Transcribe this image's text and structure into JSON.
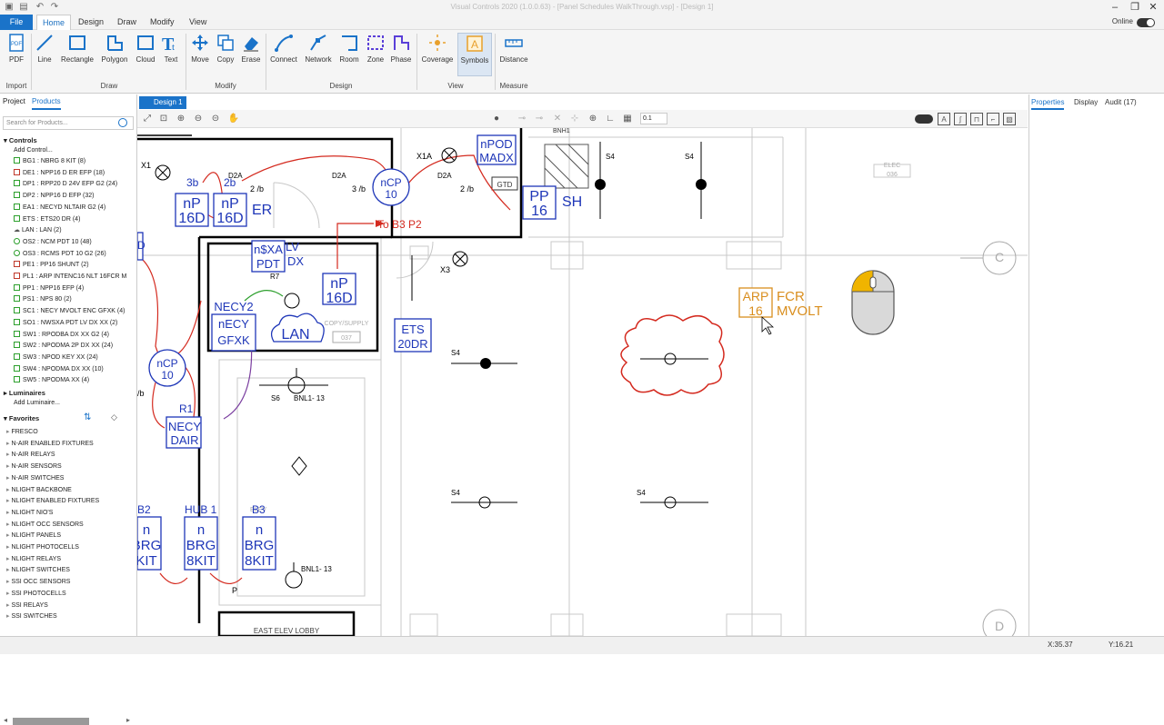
{
  "window": {
    "title": "Visual Controls 2020 (1.0.0.63) - [Panel Schedules WalkThrough.vsp] - [Design 1]",
    "online_label": "Online"
  },
  "menu": [
    "File",
    "Home",
    "Design",
    "Draw",
    "Modify",
    "View"
  ],
  "ribbon": {
    "tools": [
      {
        "id": "pdf",
        "label": "PDF"
      },
      {
        "id": "line",
        "label": "Line"
      },
      {
        "id": "rectangle",
        "label": "Rectangle"
      },
      {
        "id": "polygon",
        "label": "Polygon"
      },
      {
        "id": "cloud",
        "label": "Cloud"
      },
      {
        "id": "text",
        "label": "Text"
      },
      {
        "id": "move",
        "label": "Move"
      },
      {
        "id": "copy",
        "label": "Copy"
      },
      {
        "id": "erase",
        "label": "Erase"
      },
      {
        "id": "connect",
        "label": "Connect"
      },
      {
        "id": "network",
        "label": "Network"
      },
      {
        "id": "room",
        "label": "Room"
      },
      {
        "id": "zone",
        "label": "Zone"
      },
      {
        "id": "phase",
        "label": "Phase"
      },
      {
        "id": "coverage",
        "label": "Coverage"
      },
      {
        "id": "symbols",
        "label": "Symbols"
      },
      {
        "id": "distance",
        "label": "Distance"
      }
    ],
    "groups": [
      "Import",
      "Draw",
      "Modify",
      "Design",
      "View",
      "Measure"
    ]
  },
  "left_panel": {
    "tabs": [
      "Project",
      "Products"
    ],
    "search_placeholder": "Search for Products...",
    "controls_header": "Controls",
    "add_control": "Add Control...",
    "controls": [
      {
        "label": "BG1 : NBRG 8 KIT (8)",
        "color": "#2c9f2c",
        "shape": "square"
      },
      {
        "label": "DE1 : NPP16 D ER EFP (18)",
        "color": "#c0392b",
        "shape": "square"
      },
      {
        "label": "DP1 : RPP20 D 24V EFP G2 (24)",
        "color": "#2c9f2c",
        "shape": "square"
      },
      {
        "label": "DP2 : NPP16 D EFP (32)",
        "color": "#2c9f2c",
        "shape": "square"
      },
      {
        "label": "EA1 : NECYD NLTAIR G2 (4)",
        "color": "#2c9f2c",
        "shape": "square"
      },
      {
        "label": "ETS : ETS20 DR (4)",
        "color": "#2c9f2c",
        "shape": "square"
      },
      {
        "label": "LAN : LAN (2)",
        "color": "#555",
        "shape": "cloud"
      },
      {
        "label": "OS2 : NCM PDT 10 (48)",
        "color": "#2c9f2c",
        "shape": "circle"
      },
      {
        "label": "OS3 : RCMS PDT 10 G2 (26)",
        "color": "#2c9f2c",
        "shape": "circle"
      },
      {
        "label": "PE1 : PP16 SHUNT (2)",
        "color": "#c0392b",
        "shape": "square"
      },
      {
        "label": "PL1 : ARP INTENC16 NLT 16FCR M",
        "color": "#c0392b",
        "shape": "square"
      },
      {
        "label": "PP1 : NPP16 EFP (4)",
        "color": "#2c9f2c",
        "shape": "square"
      },
      {
        "label": "PS1 : NPS 80 (2)",
        "color": "#2c9f2c",
        "shape": "square"
      },
      {
        "label": "SC1 : NECY MVOLT ENC GFXK (4)",
        "color": "#2c9f2c",
        "shape": "square"
      },
      {
        "label": "SO1 : NWSXA PDT LV DX XX (2)",
        "color": "#2c9f2c",
        "shape": "square"
      },
      {
        "label": "SW1 : RPODBA DX XX G2 (4)",
        "color": "#2c9f2c",
        "shape": "square"
      },
      {
        "label": "SW2 : NPODMA 2P DX XX (24)",
        "color": "#2c9f2c",
        "shape": "square"
      },
      {
        "label": "SW3 : NPOD KEY XX (24)",
        "color": "#2c9f2c",
        "shape": "square"
      },
      {
        "label": "SW4 : NPODMA DX XX (10)",
        "color": "#2c9f2c",
        "shape": "square"
      },
      {
        "label": "SW5 : NPODMA XX (4)",
        "color": "#2c9f2c",
        "shape": "square"
      }
    ],
    "luminaires_header": "Luminaires",
    "add_luminaire": "Add Luminaire...",
    "favorites_header": "Favorites",
    "favorites": [
      "FRESCO",
      "N-AIR ENABLED FIXTURES",
      "N-AIR RELAYS",
      "N-AIR SENSORS",
      "N-AIR SWITCHES",
      "NLIGHT BACKBONE",
      "NLIGHT ENABLED FIXTURES",
      "NLIGHT NIO'S",
      "NLIGHT OCC SENSORS",
      "NLIGHT PANELS",
      "NLIGHT PHOTOCELLS",
      "NLIGHT RELAYS",
      "NLIGHT SWITCHES",
      "SSI OCC SENSORS",
      "SSI PHOTOCELLS",
      "SSI RELAYS",
      "SSI SWITCHES"
    ]
  },
  "canvas": {
    "tab": "Design 1",
    "zoom": "0.1"
  },
  "drawing": {
    "labels": {
      "x1": "X1",
      "x1a": "X1A",
      "x3": "X3",
      "d2a": "D2A",
      "b3b": "3b",
      "b2b": "2b",
      "b2b2": "2 /b",
      "b3b2": "3 /b",
      "b2b3": "2 /b",
      "er": "ER",
      "to_b3": "To B3 P2",
      "gtd": "GTD",
      "bnh1": "BNH1",
      "sh": "SH",
      "elec": "ELEC",
      "elec_num": "036",
      "c": "C",
      "d": "D",
      "copy_supply": "COPY/SUPPLY",
      "copy_num": "037",
      "east_elev": "EAST ELEV LOBBY",
      "s4": "S4",
      "s6": "S6",
      "bnl1": "BNL1- 13",
      "bnl2": "BNL1- 13",
      "r1": "R1",
      "hub": "HUB 1",
      "b2": "B2",
      "b3": "B3",
      "r7": "R7",
      "p": "P",
      "s": "S",
      "lv": "LV",
      "dx": "DX",
      "arp_fcr": "FCR",
      "arp_mvolt": "MVOLT",
      "nine": "9",
      "four": "4",
      "b": "/b",
      "d_frag": "D",
      "elev": "ELEV"
    },
    "boxes": {
      "np16d_a": [
        "nP",
        "16D"
      ],
      "np16d_b": [
        "nP",
        "16D"
      ],
      "npod": [
        "nPOD",
        "MADX"
      ],
      "pp16": [
        "PP",
        "16"
      ],
      "nsxa": [
        "n$XA",
        "PDT"
      ],
      "np16d_c": [
        "nP",
        "16D"
      ],
      "necy2": [
        "NECY2",
        "nECY",
        "GFXK"
      ],
      "lan": [
        "LAN"
      ],
      "ets": [
        "ETS",
        "20DR"
      ],
      "necy": [
        "NECY",
        "DAIR"
      ],
      "ncp10a": [
        "nCP",
        "10"
      ],
      "ncp10b": [
        "nCP",
        "10"
      ],
      "brg_a": [
        "n",
        "BRG",
        "KIT"
      ],
      "brg_b": [
        "n",
        "BRG",
        "8KIT"
      ],
      "brg_c": [
        "n",
        "BRG",
        "8KIT"
      ],
      "arp": [
        "ARP",
        "16"
      ]
    }
  },
  "right_panel": {
    "tabs": [
      "Properties",
      "Display",
      "Audit (17)"
    ]
  },
  "status": {
    "x": "X:35.37",
    "y": "Y:16.21"
  },
  "colors": {
    "accent": "#1a73c9",
    "drawing_blue": "#1e36b8",
    "red_wire": "#d42a1f",
    "arp_orange": "#d98e1e"
  }
}
